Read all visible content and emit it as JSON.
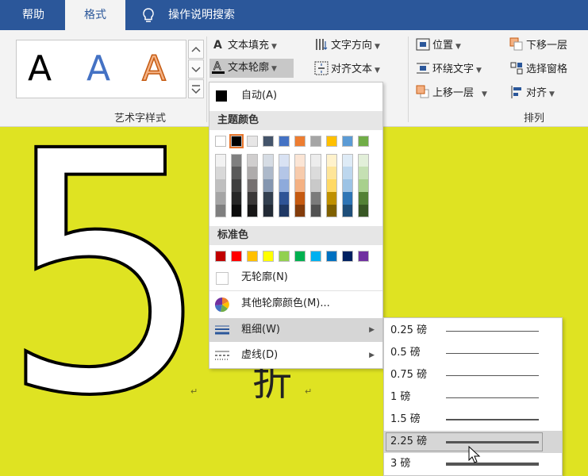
{
  "tabs": [
    {
      "label": "帮助"
    },
    {
      "label": "格式"
    },
    {
      "label": "操作说明搜索"
    }
  ],
  "ribbon": {
    "wordart": {
      "letters": [
        "A",
        "A",
        "A"
      ],
      "group_label": "艺术字样式"
    },
    "text_fill": "文本填充",
    "text_outline": "文本轮廓",
    "text_direction": "文字方向",
    "align_text": "对齐文本",
    "position": "位置",
    "wrap_text": "环绕文字",
    "bring_forward": "上移一层",
    "send_backward": "下移一层",
    "selection_pane": "选择窗格",
    "align": "对齐",
    "arrange_label": "排列"
  },
  "document": {
    "big_number": "5",
    "text": "折",
    "para_mark": "↵"
  },
  "outline_menu": {
    "auto": "自动(A)",
    "theme_header": "主题颜色",
    "standard_header": "标准色",
    "no_outline": "无轮廓(N)",
    "more_colors": "其他轮廓颜色(M)...",
    "weight": "粗细(W)",
    "dashes": "虚线(D)",
    "theme_colors": [
      "#ffffff",
      "#000000",
      "#e7e6e6",
      "#44546a",
      "#4472c4",
      "#ed7d31",
      "#a5a5a5",
      "#ffc000",
      "#5b9bd5",
      "#70ad47"
    ],
    "theme_shades": [
      [
        "#f2f2f2",
        "#7f7f7f",
        "#d0cece",
        "#d6dce4",
        "#d9e2f3",
        "#fbe5d5",
        "#ededed",
        "#fff2cc",
        "#deebf6",
        "#e2efd9"
      ],
      [
        "#d8d8d8",
        "#595959",
        "#aeabab",
        "#adb9ca",
        "#b4c6e7",
        "#f7cbac",
        "#dbdbdb",
        "#fee599",
        "#bdd7ee",
        "#c5e0b3"
      ],
      [
        "#bfbfbf",
        "#3f3f3f",
        "#757070",
        "#8496b0",
        "#8eaadb",
        "#f4b183",
        "#c9c9c9",
        "#ffd965",
        "#9cc3e5",
        "#a8d08d"
      ],
      [
        "#a5a5a5",
        "#262626",
        "#3a3838",
        "#323f4f",
        "#2f5496",
        "#c55a11",
        "#7b7b7b",
        "#bf9000",
        "#2e75b5",
        "#538135"
      ],
      [
        "#7f7f7f",
        "#0c0c0c",
        "#171616",
        "#222a35",
        "#1f3864",
        "#833c0b",
        "#525252",
        "#7f6000",
        "#1e4e79",
        "#375623"
      ]
    ],
    "standard_colors": [
      "#c00000",
      "#ff0000",
      "#ffc000",
      "#ffff00",
      "#92d050",
      "#00b050",
      "#00b0f0",
      "#0070c0",
      "#002060",
      "#7030a0"
    ]
  },
  "weight_submenu": {
    "items": [
      {
        "label": "0.25 磅",
        "weight": 0.25
      },
      {
        "label": "0.5 磅",
        "weight": 0.5
      },
      {
        "label": "0.75 磅",
        "weight": 0.75
      },
      {
        "label": "1 磅",
        "weight": 1
      },
      {
        "label": "1.5 磅",
        "weight": 1.5
      },
      {
        "label": "2.25 磅",
        "weight": 2.25
      },
      {
        "label": "3 磅",
        "weight": 3
      }
    ],
    "highlighted": "2.25 磅"
  },
  "colors": {
    "tab_bar": "#2b579a",
    "document_bg": "#dfe322",
    "selected_swatch_outline": "#e8762c"
  }
}
